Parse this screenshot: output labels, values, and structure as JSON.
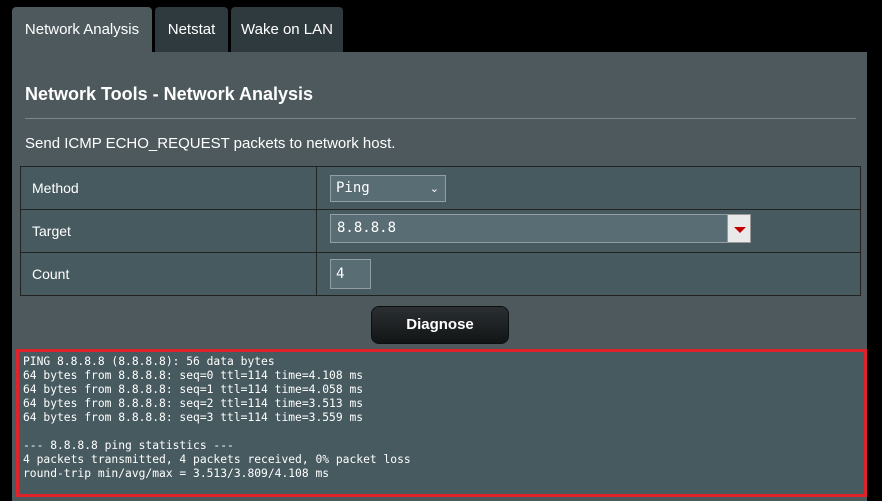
{
  "tabs": [
    {
      "label": "Network Analysis",
      "active": true
    },
    {
      "label": "Netstat",
      "active": false
    },
    {
      "label": "Wake on LAN",
      "active": false
    }
  ],
  "page": {
    "title": "Network Tools - Network Analysis",
    "description": "Send ICMP ECHO_REQUEST packets to network host."
  },
  "form": {
    "method_label": "Method",
    "method_value": "Ping",
    "target_label": "Target",
    "target_value": "8.8.8.8",
    "count_label": "Count",
    "count_value": "4"
  },
  "diagnose_label": "Diagnose",
  "output_text": "PING 8.8.8.8 (8.8.8.8): 56 data bytes\n64 bytes from 8.8.8.8: seq=0 ttl=114 time=4.108 ms\n64 bytes from 8.8.8.8: seq=1 ttl=114 time=4.058 ms\n64 bytes from 8.8.8.8: seq=2 ttl=114 time=3.513 ms\n64 bytes from 8.8.8.8: seq=3 ttl=114 time=3.559 ms\n\n--- 8.8.8.8 ping statistics ---\n4 packets transmitted, 4 packets received, 0% packet loss\nround-trip min/avg/max = 3.513/3.809/4.108 ms",
  "colors": {
    "panel": "#4d595d",
    "highlight_border": "#e0232b",
    "dropdown_arrow": "#c00000"
  }
}
